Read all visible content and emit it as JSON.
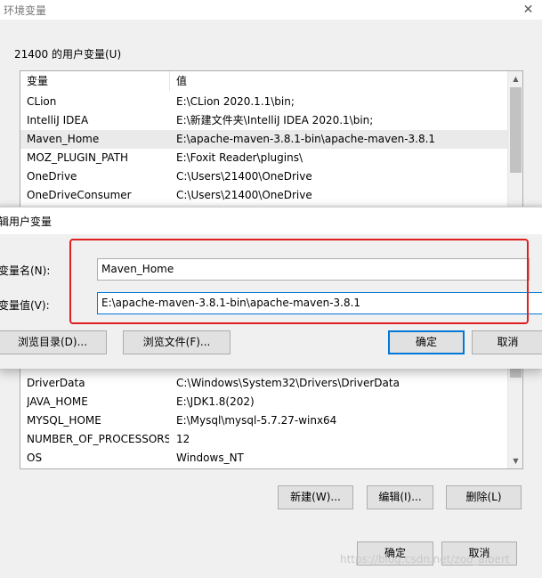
{
  "main_window": {
    "title": "环境变量",
    "close_glyph": "✕",
    "user_group_label": "21400 的用户变量(U)",
    "user_list": {
      "columns": [
        "变量",
        "值"
      ],
      "rows": [
        {
          "name": "CLion",
          "value": "E:\\CLion 2020.1.1\\bin;"
        },
        {
          "name": "IntelliJ IDEA",
          "value": "E:\\新建文件夹\\IntelliJ IDEA 2020.1\\bin;"
        },
        {
          "name": "Maven_Home",
          "value": "E:\\apache-maven-3.8.1-bin\\apache-maven-3.8.1"
        },
        {
          "name": "MOZ_PLUGIN_PATH",
          "value": "E:\\Foxit Reader\\plugins\\"
        },
        {
          "name": "OneDrive",
          "value": "C:\\Users\\21400\\OneDrive"
        },
        {
          "name": "OneDriveConsumer",
          "value": "C:\\Users\\21400\\OneDrive"
        }
      ],
      "selected_index": 2
    },
    "system_list": {
      "rows": [
        {
          "name": "DriverData",
          "value": "C:\\Windows\\System32\\Drivers\\DriverData"
        },
        {
          "name": "JAVA_HOME",
          "value": "E:\\JDK1.8(202)"
        },
        {
          "name": "MYSQL_HOME",
          "value": "E:\\Mysql\\mysql-5.7.27-winx64"
        },
        {
          "name": "NUMBER_OF_PROCESSORS",
          "value": "12"
        },
        {
          "name": "OS",
          "value": "Windows_NT"
        }
      ]
    },
    "system_buttons": {
      "new": "新建(W)...",
      "edit": "编辑(I)...",
      "delete": "删除(L)"
    },
    "footer_buttons": {
      "ok": "确定",
      "cancel": "取消"
    },
    "watermark": "https://blog.csdn.net/zoo_albert"
  },
  "edit_dialog": {
    "title": "辑用户变量",
    "name_label": "变量名(N):",
    "value_label": "变量值(V):",
    "name_value": "Maven_Home",
    "value_value": "E:\\apache-maven-3.8.1-bin\\apache-maven-3.8.1",
    "browse_dir": "浏览目录(D)...",
    "browse_file": "浏览文件(F)...",
    "ok": "确定",
    "cancel": "取消"
  },
  "colors": {
    "highlight": "#e02020",
    "focus_border": "#0078d7",
    "selected_row": "#eaeaea"
  }
}
